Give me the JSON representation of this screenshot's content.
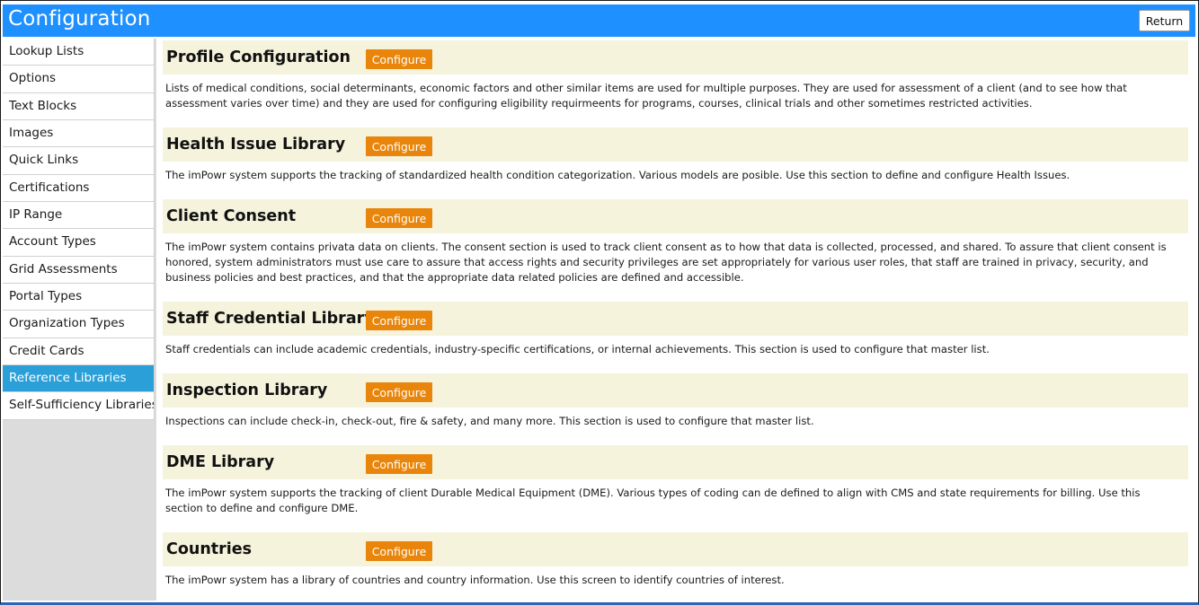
{
  "window": {
    "title": "Configuration",
    "return_label": "Return"
  },
  "sidebar": {
    "items": [
      {
        "label": "Lookup Lists",
        "active": false
      },
      {
        "label": "Options",
        "active": false
      },
      {
        "label": "Text Blocks",
        "active": false
      },
      {
        "label": "Images",
        "active": false
      },
      {
        "label": "Quick Links",
        "active": false
      },
      {
        "label": "Certifications",
        "active": false
      },
      {
        "label": "IP Range",
        "active": false
      },
      {
        "label": "Account Types",
        "active": false
      },
      {
        "label": "Grid Assessments",
        "active": false
      },
      {
        "label": "Portal Types",
        "active": false
      },
      {
        "label": "Organization Types",
        "active": false
      },
      {
        "label": "Credit Cards",
        "active": false
      },
      {
        "label": "Reference Libraries",
        "active": true
      },
      {
        "label": "Self-Sufficiency Libraries",
        "active": false
      }
    ]
  },
  "sections": [
    {
      "title": "Profile Configuration",
      "button_label": "Configure",
      "description": "Lists of medical conditions, social determinants, economic factors and other similar items are used for multiple purposes. They are used for assessment of a client (and to see how that assessment varies over time) and they are used for configuring eligibility requirmeents for programs, courses, clinical trials and other sometimes restricted activities."
    },
    {
      "title": "Health Issue Library",
      "button_label": "Configure",
      "description": "The imPowr system supports the tracking of standardized health condition categorization. Various models are posible. Use this section to define and configure Health Issues."
    },
    {
      "title": "Client Consent",
      "button_label": "Configure",
      "description": "The imPowr system contains privata data on clients. The consent section is used to track client consent as to how that data is collected, processed, and shared. To assure that client consent is honored, system administrators must use care to assure that access rights and security privileges are set appropriately for various user roles, that staff are trained in privacy, security, and business policies and best practices, and that the appropriate data related policies are defined and accessible."
    },
    {
      "title": "Staff Credential Library",
      "button_label": "Configure",
      "description": "Staff credentials can include academic credentials, industry-specific certifications, or internal achievements. This section is used to configure that master list."
    },
    {
      "title": "Inspection Library",
      "button_label": "Configure",
      "description": "Inspections can include check-in, check-out, fire & safety, and many more. This section is used to configure that master list."
    },
    {
      "title": "DME Library",
      "button_label": "Configure",
      "description": "The imPowr system supports the tracking of client Durable Medical Equipment (DME). Various types of coding can de defined to align with CMS and state requirements for billing. Use this section to define and configure DME."
    },
    {
      "title": "Countries",
      "button_label": "Configure",
      "description": "The imPowr system has a library of countries and country information. Use this screen to identify countries of interest."
    }
  ],
  "colors": {
    "title_bar": "#1e90ff",
    "active_item": "#2a9fd8",
    "configure_button": "#e8850a",
    "section_header_bg": "#f5f3dc"
  }
}
